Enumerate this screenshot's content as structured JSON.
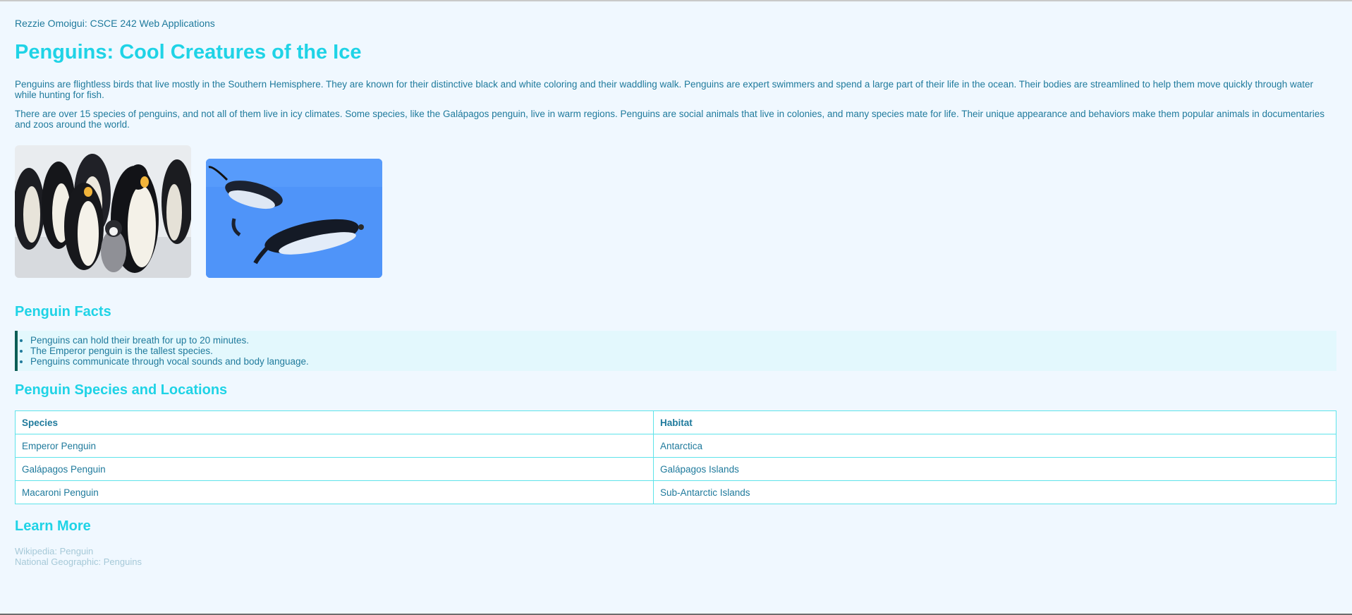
{
  "author": "Rezzie Omoigui: CSCE 242 Web Applications",
  "title": "Penguins: Cool Creatures of the Ice",
  "paragraphs": [
    "Penguins are flightless birds that live mostly in the Southern Hemisphere. They are known for their distinctive black and white coloring and their waddling walk. Penguins are expert swimmers and spend a large part of their life in the ocean. Their bodies are streamlined to help them move quickly through water while hunting for fish.",
    "There are over 15 species of penguins, and not all of them live in icy climates. Some species, like the Galápagos penguin, live in warm regions. Penguins are social animals that live in colonies, and many species mate for life. Their unique appearance and behaviors make them popular animals in documentaries and zoos around the world."
  ],
  "images": [
    {
      "name": "emperor-penguins-image"
    },
    {
      "name": "swimming-penguins-image"
    }
  ],
  "facts": {
    "heading": "Penguin Facts",
    "items": [
      "Penguins can hold their breath for up to 20 minutes.",
      "The Emperor penguin is the tallest species.",
      "Penguins communicate through vocal sounds and body language."
    ]
  },
  "species": {
    "heading": "Penguin Species and Locations",
    "columns": [
      "Species",
      "Habitat"
    ],
    "rows": [
      [
        "Emperor Penguin",
        "Antarctica"
      ],
      [
        "Galápagos Penguin",
        "Galápagos Islands"
      ],
      [
        "Macaroni Penguin",
        "Sub-Antarctic Islands"
      ]
    ]
  },
  "learn_more": {
    "heading": "Learn More",
    "links": [
      "Wikipedia: Penguin",
      "National Geographic: Penguins"
    ]
  },
  "colors": {
    "background": "#f0f8ff",
    "heading": "#1fd3e6",
    "text": "#1f7a9c",
    "link": "#a6c9d8",
    "facts_border": "#0d5e56",
    "facts_bg": "#e3f8fd",
    "table_border": "#5ee3ea"
  }
}
